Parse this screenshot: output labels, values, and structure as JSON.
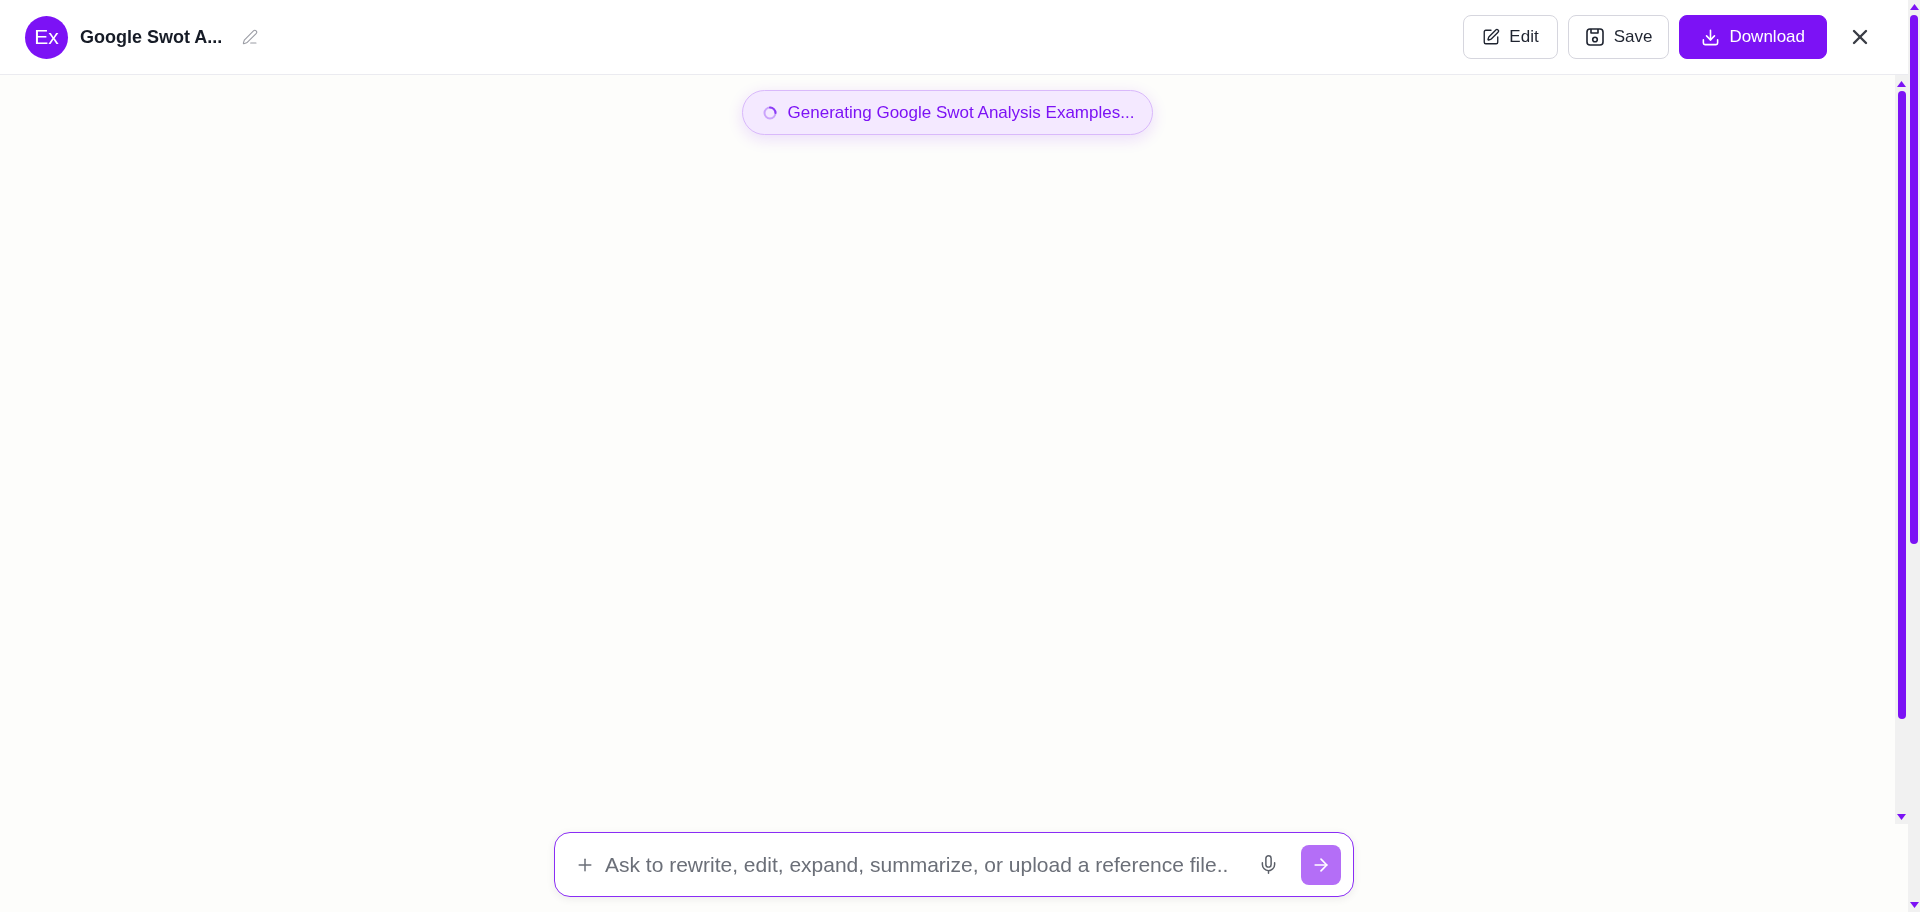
{
  "header": {
    "logo": "Ex",
    "title": "Google Swot A...",
    "actions": [
      {
        "kind": "edit",
        "label": "Edit"
      },
      {
        "kind": "save",
        "label": "Save"
      },
      {
        "kind": "download",
        "label": "Download"
      },
      {
        "kind": "close"
      }
    ]
  },
  "status": {
    "text": "Generating Google Swot Analysis Examples...",
    "loading": true
  },
  "composer": {
    "placeholder": "Ask to rewrite, edit, expand, summarize, or upload a reference file..",
    "send": {
      "disabled": true
    }
  }
}
